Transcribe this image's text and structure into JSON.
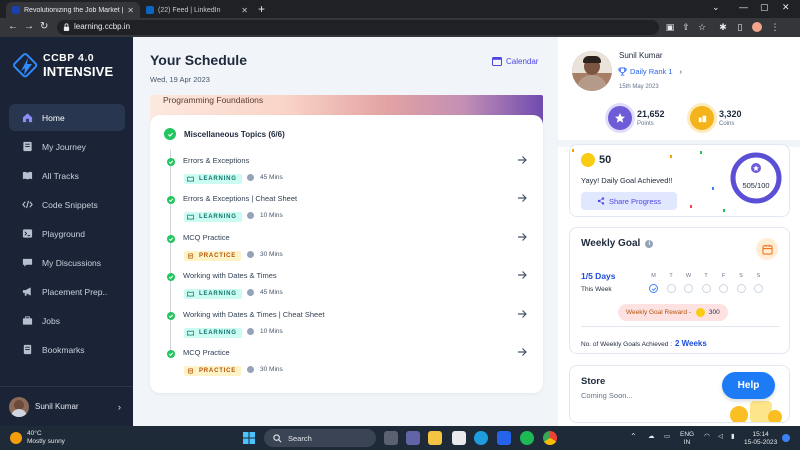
{
  "browser": {
    "tabs": [
      {
        "title": "Revolutionizing the Job Market |",
        "active": true
      },
      {
        "title": "(22) Feed | LinkedIn",
        "active": false
      }
    ],
    "url": "learning.ccbp.in"
  },
  "brand": {
    "line1": "CCBP 4.0",
    "line2": "INTENSIVE"
  },
  "sidebar": {
    "items": [
      {
        "label": "Home",
        "icon": "home-icon",
        "active": true
      },
      {
        "label": "My Journey",
        "icon": "journey-icon"
      },
      {
        "label": "All Tracks",
        "icon": "book-icon"
      },
      {
        "label": "Code Snippets",
        "icon": "code-icon"
      },
      {
        "label": "Playground",
        "icon": "terminal-icon"
      },
      {
        "label": "My Discussions",
        "icon": "chat-icon"
      },
      {
        "label": "Placement Prep..",
        "icon": "megaphone-icon"
      },
      {
        "label": "Jobs",
        "icon": "briefcase-icon"
      },
      {
        "label": "Bookmarks",
        "icon": "bookmark-icon"
      }
    ],
    "user": {
      "name": "Sunil Kumar"
    }
  },
  "schedule": {
    "title": "Your Schedule",
    "date": "Wed, 19 Apr 2023",
    "calendar_label": "Calendar",
    "course": "Programming Foundations",
    "topic": "Miscellaneous Topics (6/6)",
    "items": [
      {
        "title": "Errors & Exceptions",
        "type": "LEARNING",
        "duration": "45 Mins"
      },
      {
        "title": "Errors & Exceptions | Cheat Sheet",
        "type": "LEARNING",
        "duration": "10 Mins"
      },
      {
        "title": "MCQ Practice",
        "type": "PRACTICE",
        "duration": "30 Mins"
      },
      {
        "title": "Working with Dates & Times",
        "type": "LEARNING",
        "duration": "45 Mins"
      },
      {
        "title": "Working with Dates & Times | Cheat Sheet",
        "type": "LEARNING",
        "duration": "10 Mins"
      },
      {
        "title": "MCQ Practice",
        "type": "PRACTICE",
        "duration": "30 Mins"
      }
    ]
  },
  "profile": {
    "name": "Sunil Kumar",
    "rank_label": "Daily Rank 1",
    "date": "15th May 2023",
    "points_value": "21,652",
    "points_label": "Points",
    "coins_value": "3,320",
    "coins_label": "Coins"
  },
  "daily_goal": {
    "coins": "50",
    "message": "Yayy! Daily Goal Achieved!!",
    "share_label": "Share Progress",
    "progress_text": "505/100",
    "progress_fraction": 1.0
  },
  "weekly_goal": {
    "title": "Weekly Goal",
    "days_text": "1/5 Days",
    "week_label": "This Week",
    "day_letters": [
      "M",
      "T",
      "W",
      "T",
      "F",
      "S",
      "S"
    ],
    "days_done": [
      true,
      false,
      false,
      false,
      false,
      false,
      false
    ],
    "reward_label": "Weekly Goal Reward -",
    "reward_value": "300",
    "count_label": "No. of Weekly Goals Achieved :",
    "count_value": "2 Weeks"
  },
  "store": {
    "title": "Store",
    "subtitle": "Coming Soon...",
    "help_label": "Help"
  },
  "taskbar": {
    "temp": "40°C",
    "weather": "Mostly sunny",
    "search_label": "Search",
    "lang1": "ENG",
    "lang2": "IN",
    "time": "15:14",
    "date": "15-05-2023"
  },
  "colors": {
    "accent": "#4f46e5",
    "sidebar": "#1b2436",
    "success": "#22c55e",
    "help": "#1d7bf6"
  }
}
